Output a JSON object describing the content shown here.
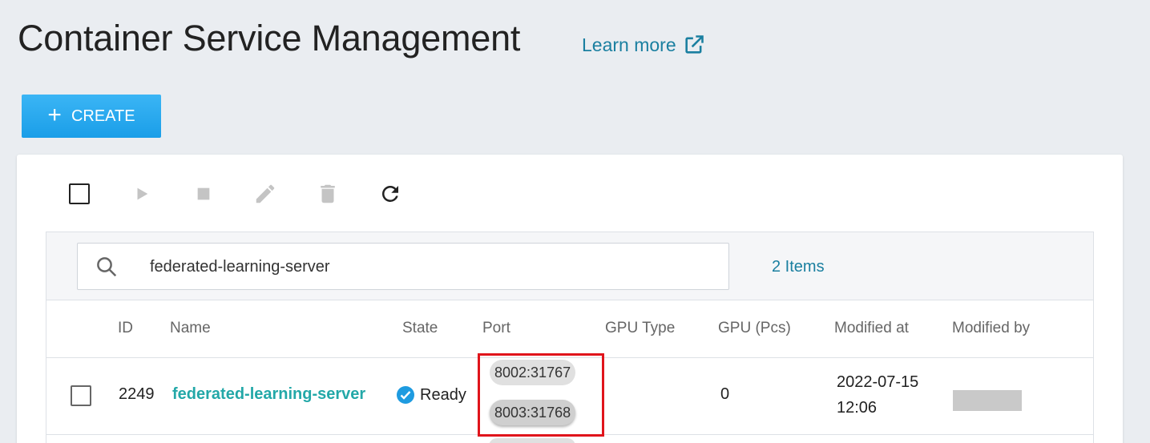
{
  "header": {
    "title": "Container Service Management",
    "learn_more": "Learn more"
  },
  "actions": {
    "create_label": "CREATE"
  },
  "search": {
    "value": "federated-learning-server",
    "items_count": "2 Items"
  },
  "table": {
    "columns": [
      "ID",
      "Name",
      "State",
      "Port",
      "GPU Type",
      "GPU (Pcs)",
      "Modified at",
      "Modified by"
    ],
    "rows": [
      {
        "id": "2249",
        "name": "federated-learning-server",
        "state": "Ready",
        "ports": [
          "8002:31767",
          "8003:31768"
        ],
        "gpu_type": "",
        "gpu_pcs": "0",
        "modified_at_date": "2022-07-15",
        "modified_at_time": "12:06"
      }
    ]
  },
  "colors": {
    "accent": "#1a9ee8",
    "link": "#1a7fa0",
    "name_link": "#23a8a8",
    "highlight_box": "#e0141b"
  },
  "icons": {
    "toolbar": [
      "select-all-checkbox",
      "play-icon",
      "stop-icon",
      "edit-icon",
      "delete-icon",
      "refresh-icon"
    ],
    "search": "search-icon",
    "state": "check-circle-icon",
    "external": "external-link-icon"
  }
}
